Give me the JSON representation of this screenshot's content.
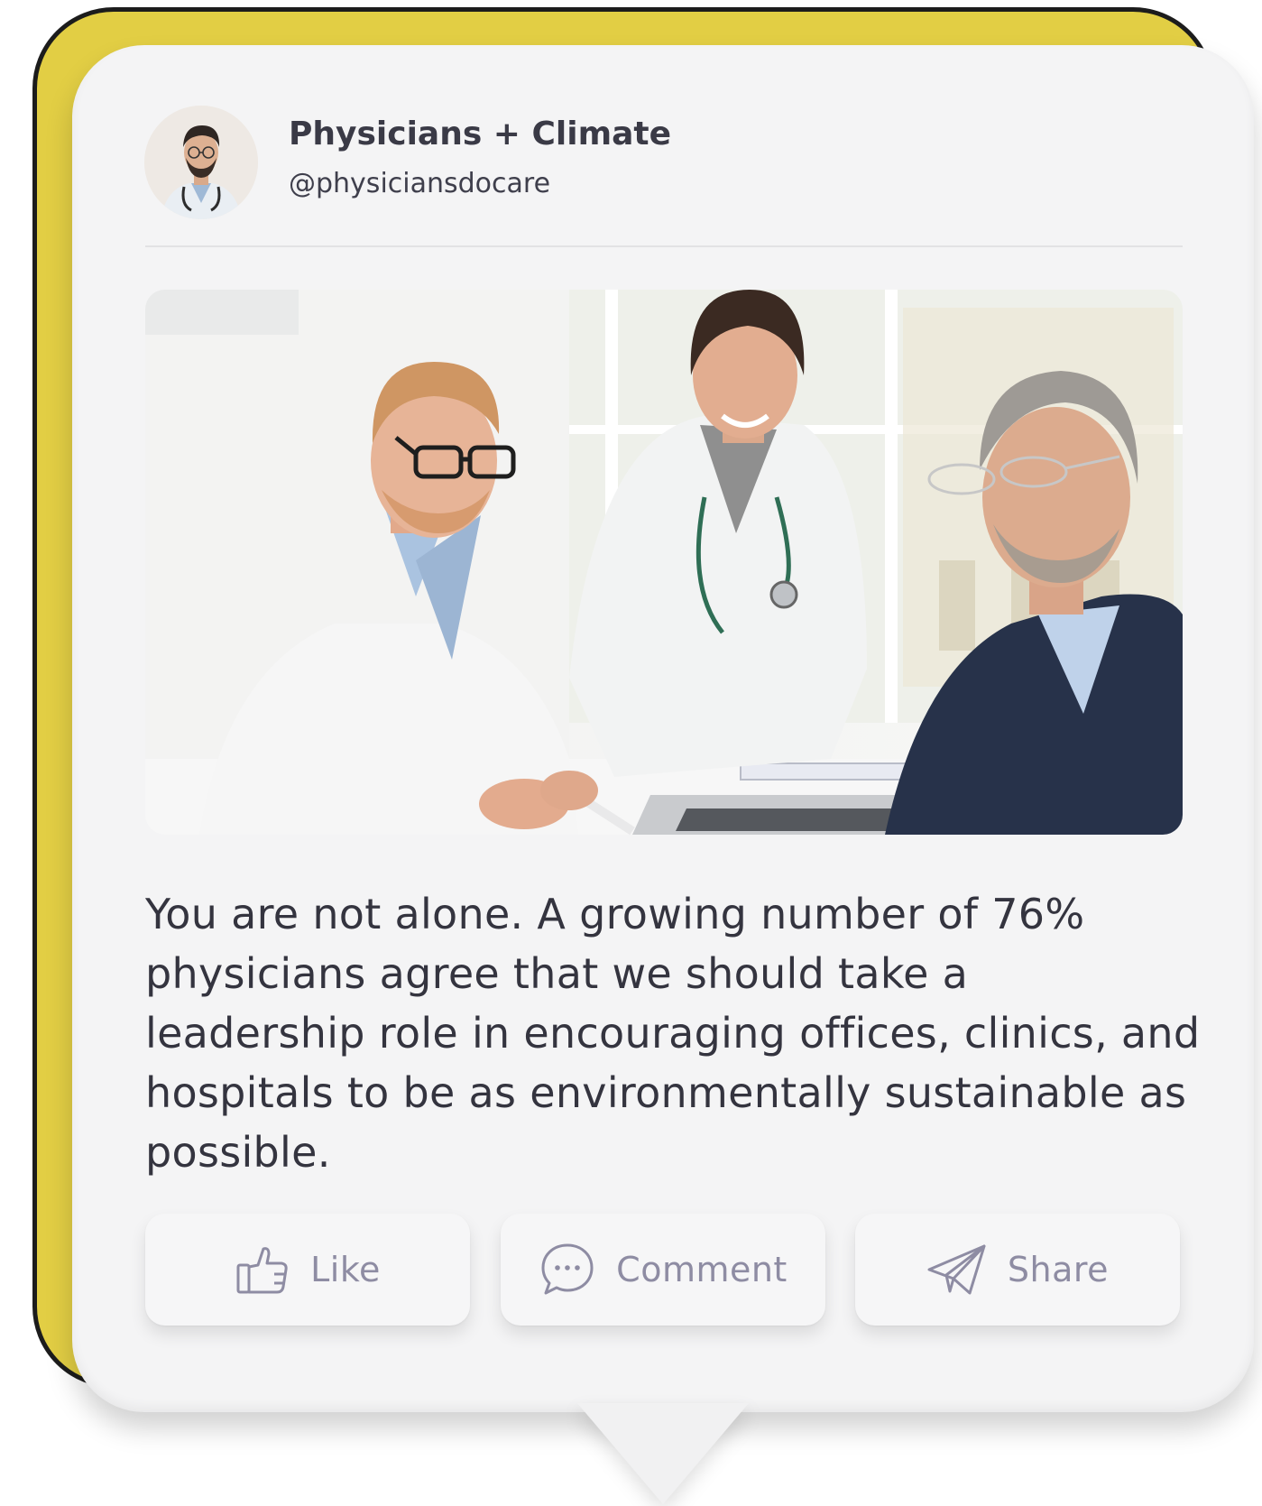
{
  "post": {
    "author": {
      "display_name": "Physicians + Climate",
      "handle": "@physiciansdocare"
    },
    "image": {
      "icon": "photo-three-doctors-at-laptop"
    },
    "text": "You are not alone. A growing number of 76% physicians agree that we should take a leadership role in encouraging offices, clinics, and hospitals to be as environmentally sustainable as possible."
  },
  "actions": {
    "like_label": "Like",
    "comment_label": "Comment",
    "share_label": "Share"
  },
  "colors": {
    "accent_yellow": "#E2CE44",
    "card_background": "#f4f4f5",
    "text_primary": "#34343f",
    "action_text": "#8e8ca3"
  }
}
